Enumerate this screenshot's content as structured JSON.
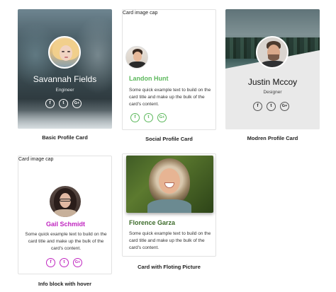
{
  "captions": {
    "basic": "Basic Profile Card",
    "social": "Social Profile Card",
    "modern": "Modren Profile Card",
    "info": "Info block with hover",
    "floating": "Card with Floting Picture"
  },
  "social_icons": {
    "facebook": "f",
    "twitter": "t",
    "google": "G+"
  },
  "basic_card": {
    "name": "Savannah Fields",
    "role": "Engineer"
  },
  "social_card": {
    "image_cap": "Card image cap",
    "title": "Landon Hunt",
    "text": "Some quick example text to build on the card title and make up the bulk of the card's content.",
    "accent": "#5cb85c"
  },
  "modern_card": {
    "name": "Justin Mccoy",
    "role": "Designer"
  },
  "info_card": {
    "image_cap": "Card image cap",
    "title": "Gail Schmidt",
    "text": "Some quick example text to build on the card title and make up the bulk of the card's content.",
    "accent": "#c026c0"
  },
  "floating_card": {
    "title": "Florence Garza",
    "text": "Some quick example text to build on the card title and make up the bulk of the card's content.",
    "accent": "#3c6b2a"
  }
}
